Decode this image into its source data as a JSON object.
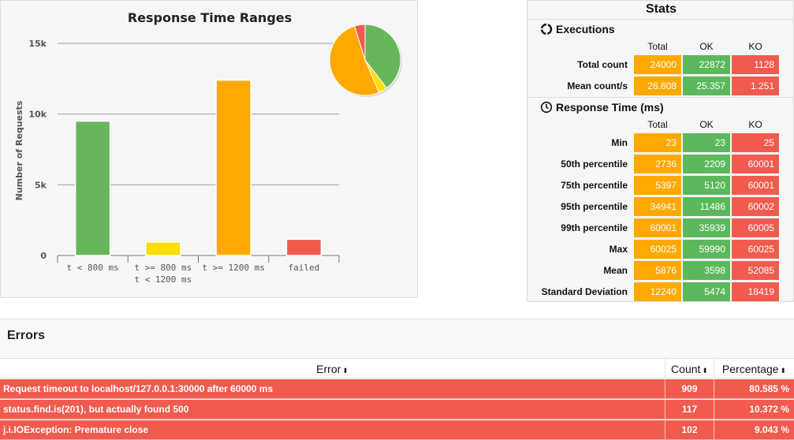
{
  "chart": {
    "title": "Response Time Ranges",
    "ylabel": "Number of Requests",
    "ticks": [
      "0",
      "5k",
      "10k",
      "15k"
    ],
    "xlabels": [
      [
        "t < 800 ms"
      ],
      [
        "t >= 800 ms",
        "t < 1200 ms"
      ],
      [
        "t >= 1200 ms"
      ],
      [
        "failed"
      ]
    ]
  },
  "chart_data": {
    "type": "bar",
    "title": "Response Time Ranges",
    "xlabel": "",
    "ylabel": "Number of Requests",
    "categories": [
      "t < 800 ms",
      "t >= 800 ms t < 1200 ms",
      "t >= 1200 ms",
      "failed"
    ],
    "values": [
      9500,
      950,
      12400,
      1150
    ],
    "colors": [
      "#68b65c",
      "#ffdd00",
      "#ffa900",
      "#f15b4f"
    ],
    "ylim": [
      0,
      15000
    ],
    "grid": true,
    "inset_pie": {
      "values": [
        9500,
        950,
        12400,
        1150
      ],
      "colors": [
        "#68b65c",
        "#ffdd00",
        "#ffa900",
        "#f15b4f"
      ]
    }
  },
  "stats": {
    "title": "Stats",
    "executions": {
      "heading": "Executions",
      "columns": [
        "Total",
        "OK",
        "KO"
      ],
      "rows": [
        {
          "label": "Total count",
          "total": "24000",
          "ok": "22872",
          "ko": "1128"
        },
        {
          "label": "Mean count/s",
          "total": "26.608",
          "ok": "25.357",
          "ko": "1.251"
        }
      ]
    },
    "response_time": {
      "heading": "Response Time (ms)",
      "columns": [
        "Total",
        "OK",
        "KO"
      ],
      "rows": [
        {
          "label": "Min",
          "total": "23",
          "ok": "23",
          "ko": "25"
        },
        {
          "label": "50th percentile",
          "total": "2736",
          "ok": "2209",
          "ko": "60001"
        },
        {
          "label": "75th percentile",
          "total": "5397",
          "ok": "5120",
          "ko": "60001"
        },
        {
          "label": "95th percentile",
          "total": "34941",
          "ok": "11486",
          "ko": "60002"
        },
        {
          "label": "99th percentile",
          "total": "60001",
          "ok": "35939",
          "ko": "60005"
        },
        {
          "label": "Max",
          "total": "60025",
          "ok": "59990",
          "ko": "60025"
        },
        {
          "label": "Mean",
          "total": "5876",
          "ok": "3598",
          "ko": "52085"
        },
        {
          "label": "Standard Deviation",
          "total": "12240",
          "ok": "5474",
          "ko": "18419"
        }
      ]
    }
  },
  "errors": {
    "title": "Errors",
    "headers": {
      "error": "Error",
      "count": "Count",
      "percentage": "Percentage"
    },
    "sort_glyph": "⬍",
    "rows": [
      {
        "error": "Request timeout to localhost/127.0.0.1:30000 after 60000 ms",
        "count": "909",
        "percentage": "80.585 %"
      },
      {
        "error": "status.find.is(201), but actually found 500",
        "count": "117",
        "percentage": "10.372 %"
      },
      {
        "error": "j.i.IOException: Premature close",
        "count": "102",
        "percentage": "9.043 %"
      }
    ]
  }
}
